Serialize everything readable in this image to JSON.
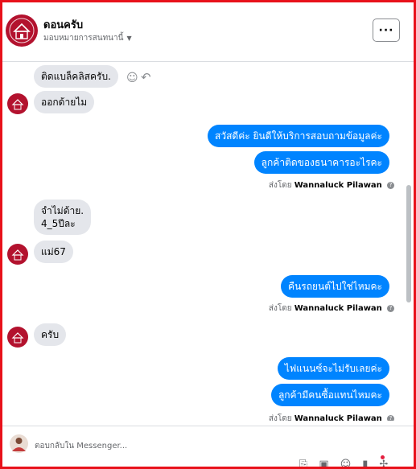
{
  "header": {
    "title": "ดอนครับ",
    "subtitle": "มอบหมายการสนทนานี้",
    "menu_label": "···"
  },
  "messages": [
    {
      "side": "in",
      "text": "ติดแบล็คลิสครับ."
    },
    {
      "side": "in",
      "text": "ออกด้ายไม"
    },
    {
      "side": "out",
      "text": "สวัสดีค่ะ  ยินดีให้บริการสอบถามข้อมูลค่ะ"
    },
    {
      "side": "out",
      "text": "ลูกค้าติดของธนาคารอะไรคะ"
    },
    {
      "side": "in",
      "text_line1": "จำไม่ด้าย.",
      "text_line2": "4_5ปีละ"
    },
    {
      "side": "in",
      "text": "แม่67"
    },
    {
      "side": "out",
      "text": "คืนรถยนต์ไปใช่ไหมคะ"
    },
    {
      "side": "in",
      "text": "ครับ"
    },
    {
      "side": "out",
      "text": "ไฟแนนซ์จะไม่รับเลยค่ะ"
    },
    {
      "side": "out",
      "text": "ลูกค้ามีคนซื้อแทนไหมคะ"
    }
  ],
  "sent_by": {
    "prefix": "ส่งโดย",
    "name": "Wannaluck Pilawan",
    "help_glyph": "?"
  },
  "composer": {
    "placeholder": "ตอบกลับใน Messenger..."
  },
  "icons": {
    "emoji": "smiley-icon",
    "reply": "reply-arrow-icon",
    "menu": "more-options-icon",
    "dropdown": "chevron-down-icon"
  },
  "colors": {
    "outgoing_bubble": "#0084ff",
    "incoming_bubble": "#e4e6eb",
    "frame_border": "#e8111b"
  }
}
